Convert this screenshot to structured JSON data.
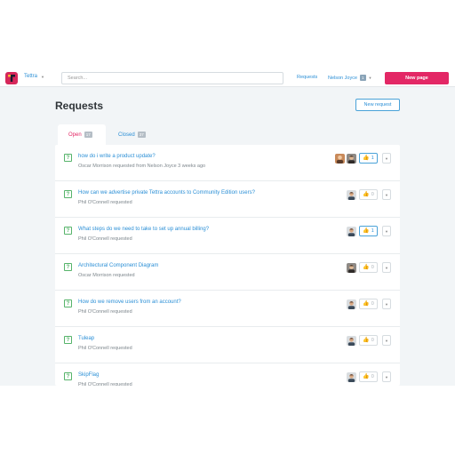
{
  "topbar": {
    "brand": "Tettra",
    "search_placeholder": "Search...",
    "nav_requests": "Requests",
    "user_name": "Nelson Joyce",
    "user_badge": "1",
    "new_page_label": "New page"
  },
  "header": {
    "title": "Requests",
    "new_request_label": "New request"
  },
  "tabs": [
    {
      "label": "Open",
      "count": "17"
    },
    {
      "label": "Closed",
      "count": "37"
    }
  ],
  "requests": [
    {
      "title": "how do i write a product update?",
      "meta": "Oscar Morrison requested from Nelson Joyce 3 weeks ago",
      "votes": "1",
      "voted": true,
      "avatars": [
        "avatar-a",
        "avatar-b"
      ]
    },
    {
      "title": "How can we advertise private Tettra accounts to Community Edition users?",
      "meta": "Phil O'Connell requested",
      "votes": "0",
      "voted": false,
      "avatars": [
        "avatar-c"
      ]
    },
    {
      "title": "What steps do we need to take to set up annual billing?",
      "meta": "Phil O'Connell requested",
      "votes": "1",
      "voted": true,
      "avatars": [
        "avatar-c"
      ]
    },
    {
      "title": "Architectural Component Diagram",
      "meta": "Oscar Morrison requested",
      "votes": "0",
      "voted": false,
      "avatars": [
        "avatar-b"
      ]
    },
    {
      "title": "How do we remove users from an account?",
      "meta": "Phil O'Connell requested",
      "votes": "0",
      "voted": false,
      "avatars": [
        "avatar-c"
      ]
    },
    {
      "title": "Tuleap",
      "meta": "Phil O'Connell requested",
      "votes": "0",
      "voted": false,
      "avatars": [
        "avatar-c"
      ]
    },
    {
      "title": "SkipFlag",
      "meta": "Phil O'Connell requested",
      "votes": "0",
      "voted": false,
      "avatars": [
        "avatar-c"
      ]
    }
  ],
  "icons": {
    "question": "?",
    "thumb": "👍",
    "caret": "▼"
  },
  "colors": {
    "accent": "#e32765",
    "link": "#2b8fd6",
    "question_green": "#57b46b"
  }
}
